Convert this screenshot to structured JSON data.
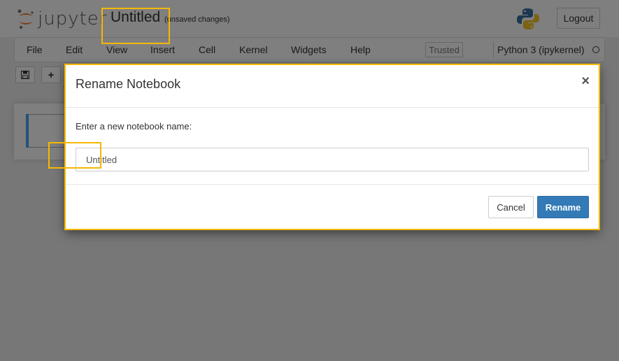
{
  "header": {
    "logo_text": "jupyter",
    "notebook_title": "Untitled",
    "save_status": "(unsaved changes)",
    "logout_label": "Logout"
  },
  "menubar": {
    "items": [
      "File",
      "Edit",
      "View",
      "Insert",
      "Cell",
      "Kernel",
      "Widgets",
      "Help"
    ],
    "trusted_label": "Trusted",
    "kernel_name": "Python 3 (ipykernel)"
  },
  "toolbar": {
    "save_icon": "save-icon",
    "add_icon": "+"
  },
  "modal": {
    "title": "Rename Notebook",
    "close_symbol": "×",
    "prompt_label": "Enter a new notebook name:",
    "input_value": "Untitled",
    "cancel_label": "Cancel",
    "rename_label": "Rename"
  },
  "colors": {
    "primary": "#337ab7",
    "highlight": "#f5b800",
    "jupyter_orange": "#f37726"
  }
}
